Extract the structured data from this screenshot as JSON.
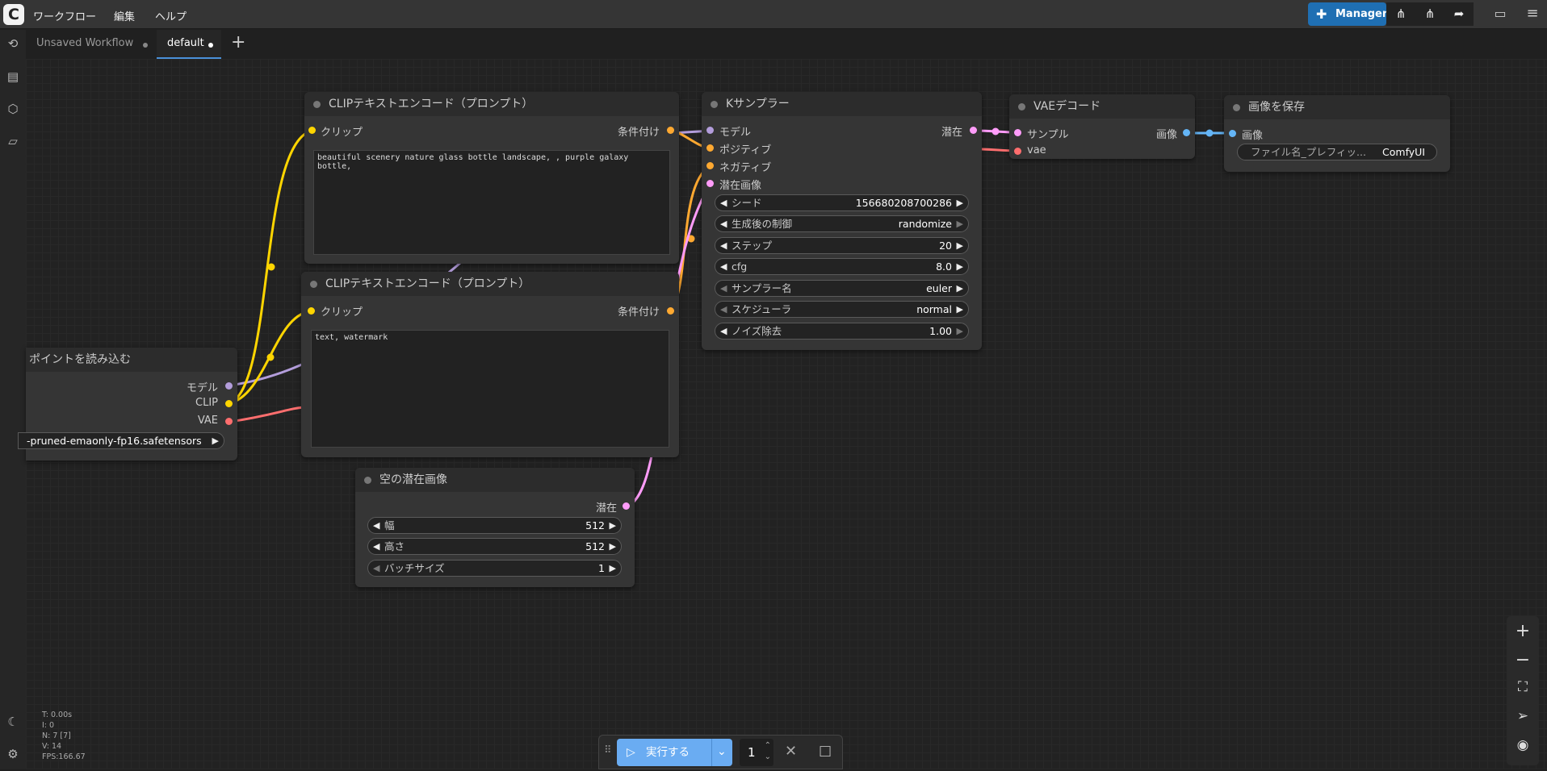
{
  "menu": {
    "workflow": "ワークフロー",
    "edit": "編集",
    "help": "ヘルプ"
  },
  "toolbar": {
    "manager_label": "Manager"
  },
  "tabs": [
    {
      "label": "Unsaved Workflow"
    },
    {
      "label": "default"
    }
  ],
  "nodes": {
    "clip_pos": {
      "title": "CLIPテキストエンコード（プロンプト）",
      "input_label": "クリップ",
      "output_label": "条件付け",
      "text": "beautiful scenery nature glass bottle landscape, , purple galaxy bottle,"
    },
    "clip_neg": {
      "title": "CLIPテキストエンコード（プロンプト）",
      "input_label": "クリップ",
      "output_label": "条件付け",
      "text": "text, watermark"
    },
    "ksampler": {
      "title": "Kサンプラー",
      "inputs": [
        "モデル",
        "ポジティブ",
        "ネガティブ",
        "潜在画像"
      ],
      "output_label": "潜在",
      "widgets": [
        {
          "label": "シード",
          "value": "156680208700286"
        },
        {
          "label": "生成後の制御",
          "value": "randomize"
        },
        {
          "label": "ステップ",
          "value": "20"
        },
        {
          "label": "cfg",
          "value": "8.0"
        },
        {
          "label": "サンプラー名",
          "value": "euler"
        },
        {
          "label": "スケジューラ",
          "value": "normal"
        },
        {
          "label": "ノイズ除去",
          "value": "1.00"
        }
      ]
    },
    "vae_decode": {
      "title": "VAEデコード",
      "inputs": [
        "サンプル",
        "vae"
      ],
      "output_label": "画像"
    },
    "save_image": {
      "title": "画像を保存",
      "input_label": "画像",
      "widget_label": "ファイル名_プレフィッ...",
      "widget_value": "ComfyUI"
    },
    "ckpt_loader": {
      "title": "ポイントを読み込む",
      "outputs": [
        "モデル",
        "CLIP",
        "VAE"
      ],
      "widget_value": "-pruned-emaonly-fp16.safetensors"
    },
    "empty_latent": {
      "title": "空の潜在画像",
      "output_label": "潜在",
      "widgets": [
        {
          "label": "幅",
          "value": "512"
        },
        {
          "label": "高さ",
          "value": "512"
        },
        {
          "label": "バッチサイズ",
          "value": "1"
        }
      ]
    }
  },
  "stats": [
    "T: 0.00s",
    "I: 0",
    "N: 7 [7]",
    "V: 14",
    "FPS:166.67"
  ],
  "runbar": {
    "run_label": "実行する",
    "batch_count": "1"
  },
  "colors": {
    "model": "#b39ddb",
    "clip": "#ffd500",
    "vae": "#ff6e6e",
    "conditioning": "#ffa931",
    "latent": "#ff9cf9",
    "image": "#64b5f6",
    "accent": "#1f6fb3"
  }
}
